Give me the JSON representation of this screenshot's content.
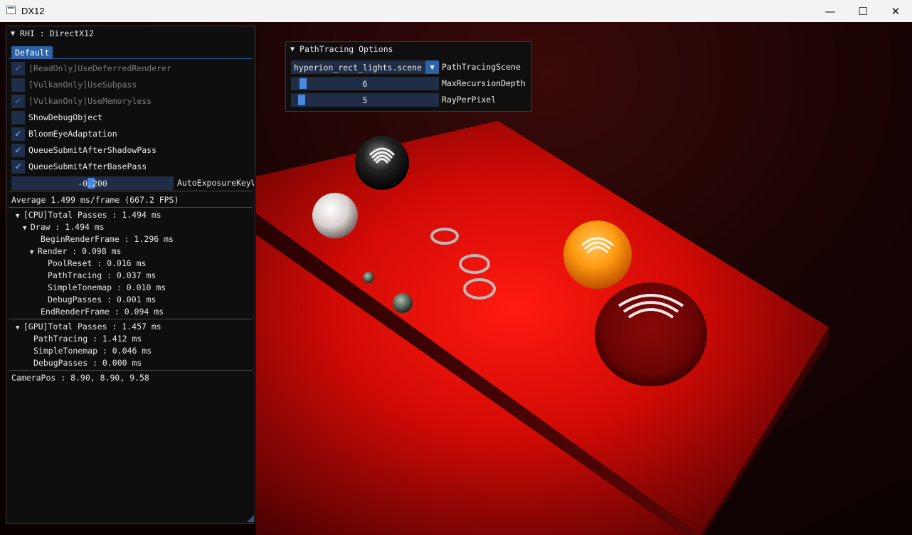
{
  "window": {
    "title": "DX12",
    "minimize_glyph": "—",
    "maximize_glyph": "☐",
    "close_glyph": "✕"
  },
  "rhi_panel": {
    "title": "RHI : DirectX12",
    "tab": "Default",
    "checkboxes": [
      {
        "label": "[ReadOnly]UseDeferredRenderer",
        "checked": true,
        "disabled": true
      },
      {
        "label": "[VulkanOnly]UseSubpass",
        "checked": false,
        "disabled": true
      },
      {
        "label": "[VulkanOnly]UseMemoryless",
        "checked": true,
        "disabled": true
      },
      {
        "label": "ShowDebugObject",
        "checked": false,
        "disabled": false
      },
      {
        "label": "BloomEyeAdaptation",
        "checked": true,
        "disabled": false
      },
      {
        "label": "QueueSubmitAfterShadowPass",
        "checked": true,
        "disabled": false
      },
      {
        "label": "QueueSubmitAfterBasePass",
        "checked": true,
        "disabled": false
      }
    ],
    "slider": {
      "value": "-0.200",
      "label": "AutoExposureKeyV"
    },
    "average": "Average 1.499 ms/frame (667.2 FPS)",
    "cpu_tree": [
      "[CPU]Total Passes : 1.494 ms",
      "Draw : 1.494 ms",
      "BeginRenderFrame : 1.296 ms",
      "Render : 0.098 ms",
      "PoolReset : 0.016 ms",
      "PathTracing : 0.037 ms",
      "SimpleTonemap : 0.010 ms",
      "DebugPasses : 0.001 ms",
      "EndRenderFrame : 0.094 ms"
    ],
    "gpu_tree": [
      "[GPU]Total Passes : 1.457 ms",
      "PathTracing : 1.412 ms",
      "SimpleTonemap : 0.046 ms",
      "DebugPasses : 0.000 ms"
    ],
    "camera_pos": "CameraPos : 8.90, 8.90, 9.58"
  },
  "pt_panel": {
    "title": "PathTracing Options",
    "scene_combo": {
      "value": "hyperion_rect_lights.scene",
      "label": "PathTracingScene"
    },
    "depth_slider": {
      "value": "6",
      "label": "MaxRecursionDepth"
    },
    "ray_slider": {
      "value": "5",
      "label": "RayPerPixel"
    }
  },
  "icons": {
    "check": "check-icon",
    "collapse": "triangle-down-icon",
    "combo_arrow": "triangle-down-icon"
  }
}
